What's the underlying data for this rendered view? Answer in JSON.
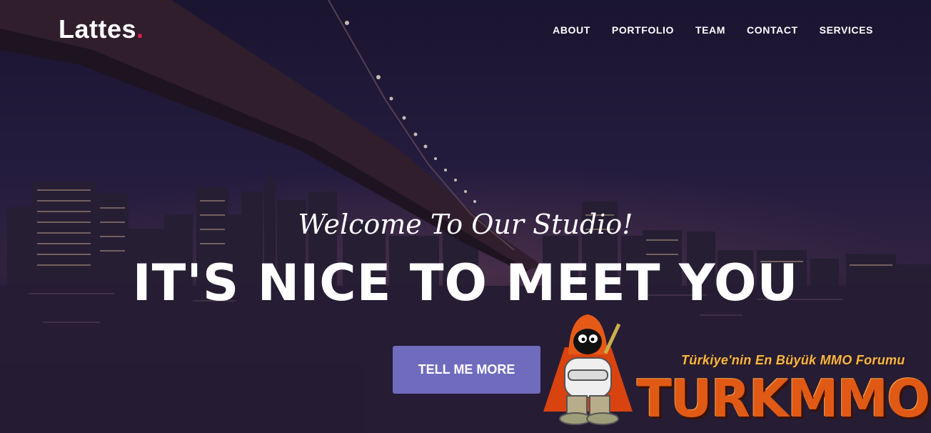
{
  "brand": {
    "name": "Lattes",
    "dot": ".",
    "dot_color": "#e0204a"
  },
  "nav": {
    "items": [
      {
        "label": "ABOUT"
      },
      {
        "label": "PORTFOLIO"
      },
      {
        "label": "TEAM"
      },
      {
        "label": "CONTACT"
      },
      {
        "label": "SERVICES"
      }
    ]
  },
  "hero": {
    "subtitle": "Welcome To Our Studio!",
    "headline": "IT'S NICE TO MEET YOU",
    "cta_label": "TELL ME MORE",
    "cta_color": "#6f6bbd"
  },
  "watermark": {
    "tagline": "Türkiye'nin En Büyük MMO Forumu",
    "logo_text": "TURKMMO"
  }
}
